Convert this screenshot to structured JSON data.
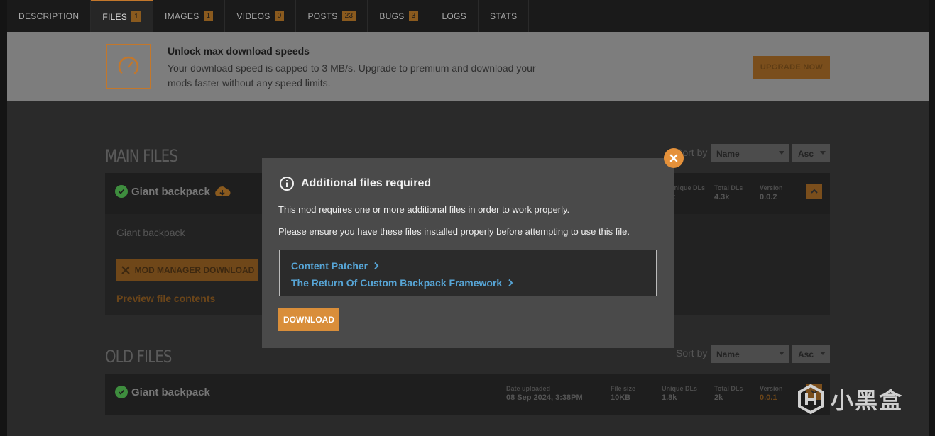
{
  "tabs": [
    {
      "label": "DESCRIPTION",
      "badge": ""
    },
    {
      "label": "FILES",
      "badge": "1"
    },
    {
      "label": "IMAGES",
      "badge": "1"
    },
    {
      "label": "VIDEOS",
      "badge": "0"
    },
    {
      "label": "POSTS",
      "badge": "23"
    },
    {
      "label": "BUGS",
      "badge": "3"
    },
    {
      "label": "LOGS",
      "badge": ""
    },
    {
      "label": "STATS",
      "badge": ""
    }
  ],
  "banner": {
    "title": "Unlock max download speeds",
    "text": "Your download speed is capped to 3 MB/s. Upgrade to premium and download your mods faster without any speed limits.",
    "button": "UPGRADE NOW",
    "icon": "speedometer-icon"
  },
  "main_files": {
    "title": "MAIN FILES",
    "sort_label": "Sort by",
    "sort_field": "Name",
    "sort_order": "Asc",
    "file": {
      "name": "Giant backpack",
      "unique_dls_label": "Unique DLs",
      "unique_dls_value": "k",
      "total_dls_label": "Total DLs",
      "total_dls_value": "4.3k",
      "version_label": "Version",
      "version_value": "0.0.2",
      "description": "Giant backpack",
      "mm_button": "MOD MANAGER DOWNLOAD",
      "preview_link": "Preview file contents"
    }
  },
  "old_files": {
    "title": "OLD FILES",
    "sort_label": "Sort by",
    "sort_field": "Name",
    "sort_order": "Asc",
    "file": {
      "name": "Giant backpack",
      "date_label": "Date uploaded",
      "date_value": "08 Sep 2024, 3:38PM",
      "size_label": "File size",
      "size_value": "10KB",
      "unique_dls_label": "Unique DLs",
      "unique_dls_value": "1.8k",
      "total_dls_label": "Total DLs",
      "total_dls_value": "2k",
      "version_label": "Version",
      "version_value": "0.0.1"
    }
  },
  "modal": {
    "title": "Additional files required",
    "p1": "This mod requires one or more additional files in order to work properly.",
    "p2": "Please ensure you have these files installed properly before attempting to use this file.",
    "requirements": [
      "Content Patcher",
      "The Return Of Custom Backpack Framework"
    ],
    "download_button": "DOWNLOAD"
  },
  "watermark": {
    "text": "小黑盒"
  },
  "colors": {
    "accent": "#e5913a",
    "link": "#57a5d6",
    "success": "#3e8d3e"
  }
}
